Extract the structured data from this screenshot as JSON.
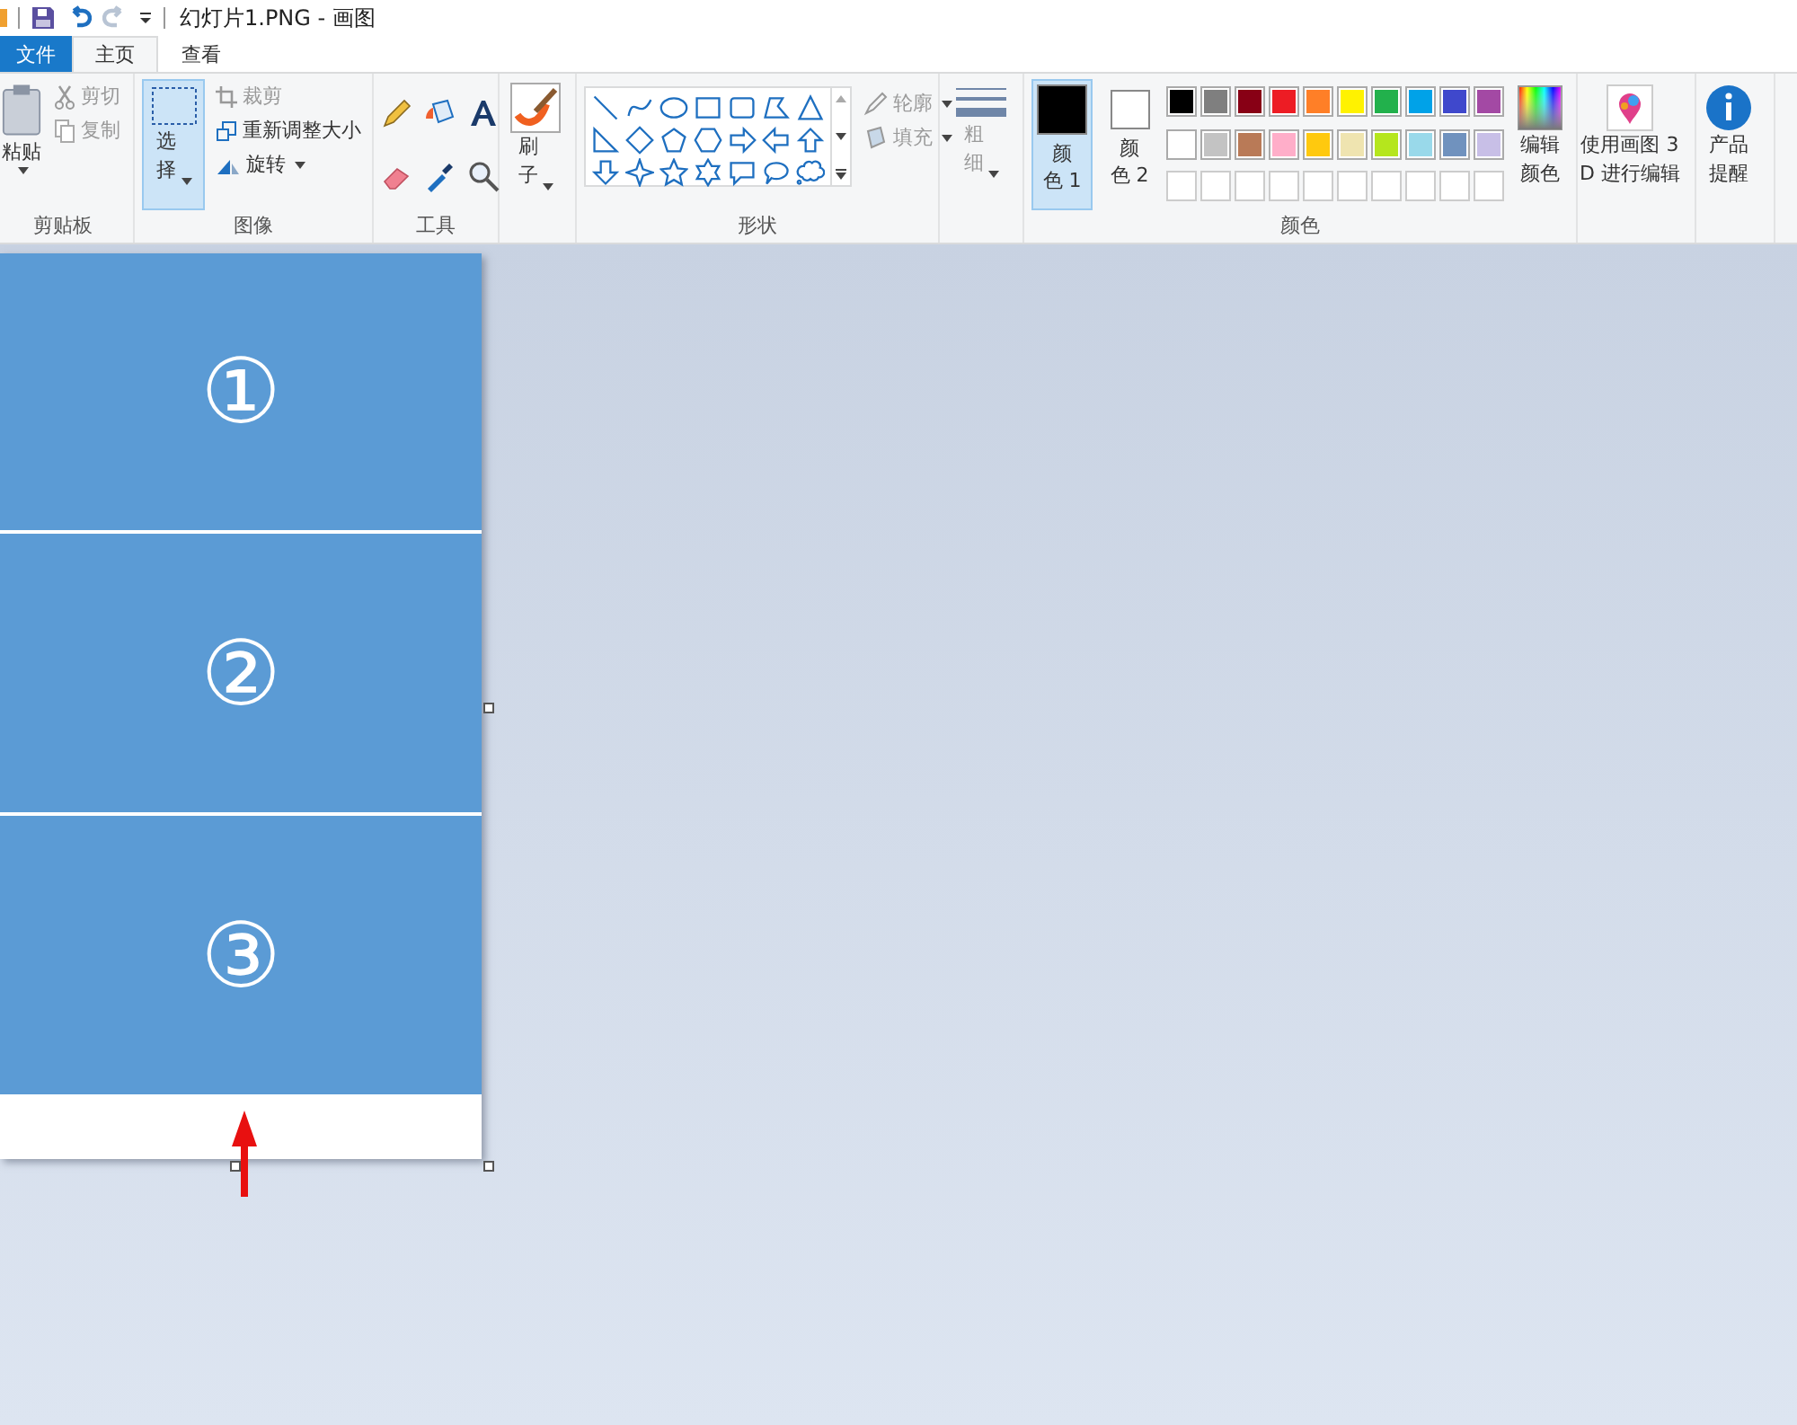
{
  "window": {
    "title": "幻灯片1.PNG - 画图"
  },
  "tabs": [
    {
      "label": "文件",
      "kind": "file",
      "selected": false
    },
    {
      "label": "主页",
      "kind": "tab",
      "selected": true
    },
    {
      "label": "查看",
      "kind": "tab",
      "selected": false
    }
  ],
  "clipboard": {
    "label": "剪贴板",
    "paste": "粘贴",
    "cut": {
      "label": "剪切",
      "disabled": true
    },
    "copy": {
      "label": "复制",
      "disabled": true
    }
  },
  "image": {
    "label": "图像",
    "select": {
      "label": "选择",
      "selected": true
    },
    "crop": {
      "label": "裁剪",
      "disabled": true
    },
    "resize": {
      "label": "重新调整大小",
      "disabled": false
    },
    "rotate": {
      "label": "旋转",
      "disabled": false
    }
  },
  "tools": {
    "label": "工具"
  },
  "brushes": {
    "label": "刷子"
  },
  "shapes": {
    "label": "形状",
    "outline": {
      "label": "轮廓",
      "disabled": true
    },
    "fill": {
      "label": "填充",
      "disabled": true
    }
  },
  "size": {
    "label": "粗细",
    "disabled": true
  },
  "colors": {
    "label": "颜色",
    "color1": {
      "label": "颜色 1",
      "color": "#000000",
      "selected": true
    },
    "color2": {
      "label": "颜色 2",
      "color": "#ffffff",
      "selected": false
    },
    "palette": [
      {
        "color": "#000000"
      },
      {
        "color": "#7f7f7f"
      },
      {
        "color": "#880015"
      },
      {
        "color": "#ed1c24"
      },
      {
        "color": "#ff7f27"
      },
      {
        "color": "#fff200"
      },
      {
        "color": "#22b14c"
      },
      {
        "color": "#00a2e8"
      },
      {
        "color": "#3f48cc"
      },
      {
        "color": "#a349a4"
      },
      {
        "color": "#ffffff"
      },
      {
        "color": "#c3c3c3"
      },
      {
        "color": "#b97a57"
      },
      {
        "color": "#ffaec9"
      },
      {
        "color": "#ffc90e"
      },
      {
        "color": "#efe4b0"
      },
      {
        "color": "#b5e61d"
      },
      {
        "color": "#99d9ea"
      },
      {
        "color": "#7092be"
      },
      {
        "color": "#c8bfe7"
      }
    ],
    "edit": "编辑颜色"
  },
  "paint3d": "使用画图 3\nD 进行编辑",
  "feedback": "产品提醒",
  "canvas": {
    "slides": [
      {
        "label": "①"
      },
      {
        "label": "②"
      },
      {
        "label": "③"
      }
    ]
  }
}
